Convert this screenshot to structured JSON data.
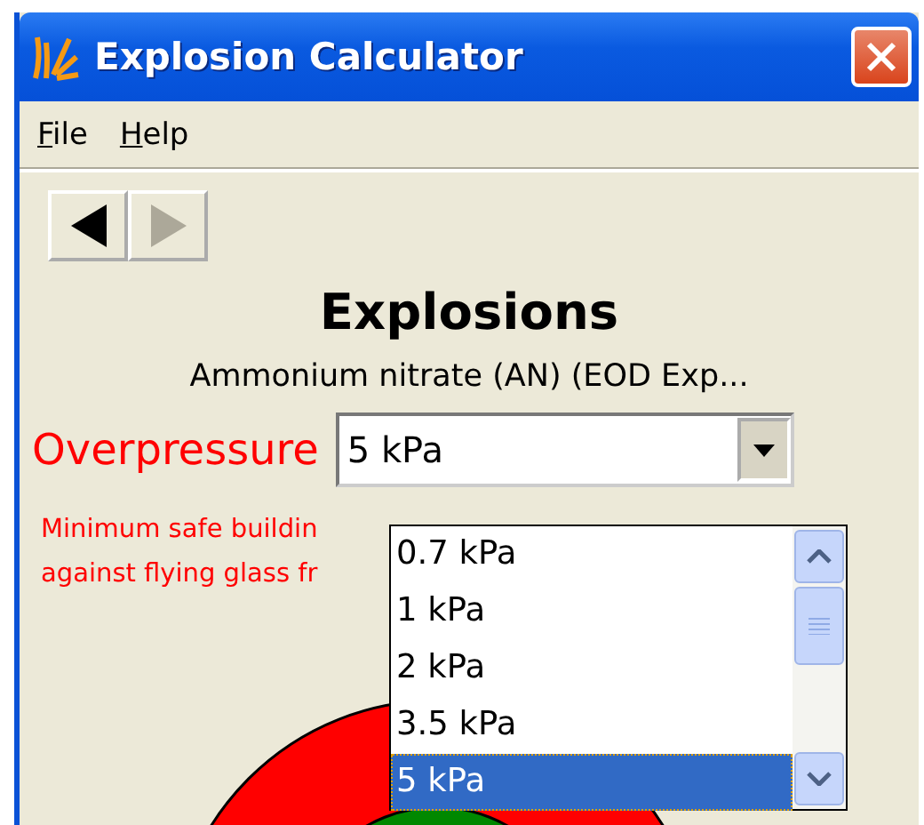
{
  "window": {
    "title": "Explosion Calculator"
  },
  "menu": [
    {
      "label": "File"
    },
    {
      "label": "Help"
    }
  ],
  "nav_buttons": [
    {
      "kind": "back",
      "disabled": false
    },
    {
      "kind": "forward",
      "disabled": true
    }
  ],
  "heading": "Explosions",
  "subtitle": "Ammonium nitrate (AN) (EOD Exp...",
  "overpressure": {
    "label": "Overpressure",
    "value": "5 kPa",
    "expanded": true,
    "options": [
      {
        "label": "0.7 kPa",
        "selected": false
      },
      {
        "label": "1 kPa",
        "selected": false
      },
      {
        "label": "2 kPa",
        "selected": false
      },
      {
        "label": "3.5 kPa",
        "selected": false
      },
      {
        "label": "5 kPa",
        "selected": true
      }
    ]
  },
  "note": [
    "Minimum safe buildin",
    "against flying glass fr"
  ]
}
